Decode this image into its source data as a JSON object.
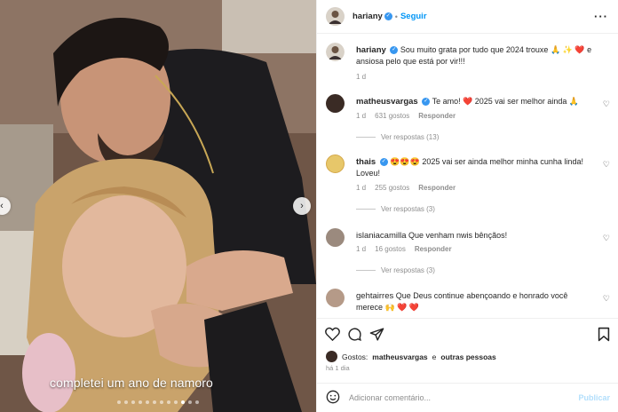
{
  "photo": {
    "caption": "completei um ano de namoro",
    "carousel_dots": 12,
    "active_dot": 9
  },
  "header": {
    "username": "hariany",
    "separator": "•",
    "follow_label": "Seguir",
    "more_icon": "more-horizontal-icon"
  },
  "post": {
    "username": "hariany",
    "text": "Sou muito grata por tudo que 2024 trouxe 🙏 ✨ ❤️ e ansiosa pelo que está por vir!!!",
    "time": "1 d"
  },
  "comments": [
    {
      "username": "matheusvargas",
      "verified": true,
      "text": "Te amo! ❤️  2025 vai ser melhor ainda 🙏",
      "time": "1 d",
      "likes": "631 gostos",
      "reply_label": "Responder",
      "view_replies": "Ver respostas (13)"
    },
    {
      "username": "thais",
      "verified": true,
      "text": "😍😍😍 2025 vai ser ainda melhor minha cunha linda! Loveu!",
      "time": "1 d",
      "likes": "255 gostos",
      "reply_label": "Responder",
      "view_replies": "Ver respostas (3)"
    },
    {
      "username": "islaniacamilla",
      "verified": false,
      "text": "Que venham nwis bênçãos!",
      "time": "1 d",
      "likes": "16 gostos",
      "reply_label": "Responder",
      "view_replies": "Ver respostas (3)"
    },
    {
      "username": "gehtairres",
      "verified": false,
      "text": "Que Deus continue abençoando e honrado você merece 🙌 ❤️ ❤️"
    }
  ],
  "actions": {
    "like_icon": "heart-icon",
    "comment_icon": "comment-icon",
    "share_icon": "share-icon",
    "save_icon": "bookmark-icon"
  },
  "likes": {
    "label": "Gostos:",
    "user": "matheusvargas",
    "connector": "e",
    "others": "outras pessoas"
  },
  "time_ago": "há 1 dia",
  "add_comment": {
    "placeholder": "Adicionar comentário...",
    "publish_label": "Publicar"
  },
  "colors": {
    "link_blue": "#0095f6",
    "verified_blue": "#3897f0",
    "muted": "#8e8e8e",
    "publish_disabled": "#b2dffc",
    "heart_red": "#ed4956"
  }
}
